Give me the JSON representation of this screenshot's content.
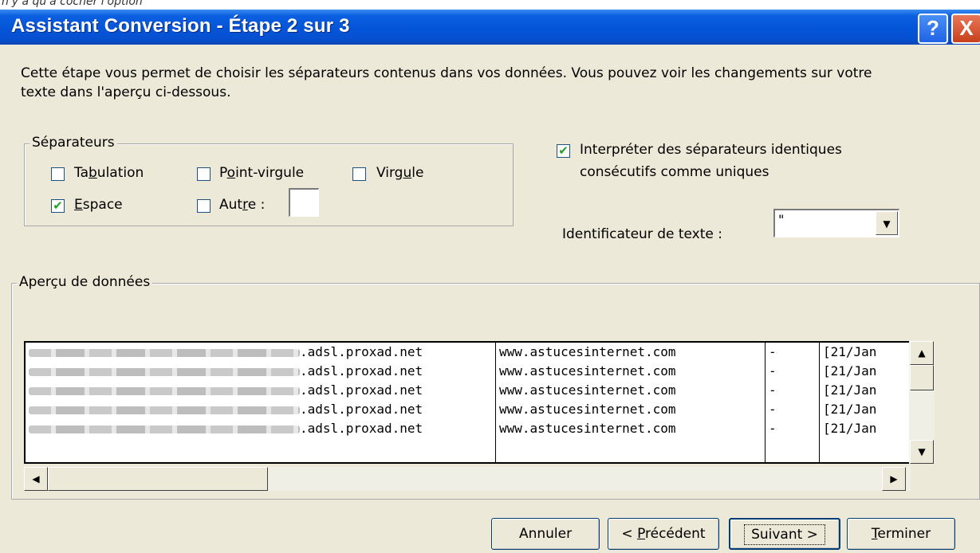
{
  "window": {
    "top_caption": "n'y a qu'à cocher l'option",
    "title": "Assistant Conversion - Étape 2 sur 3",
    "help_label": "?",
    "close_label": "X"
  },
  "description": "Cette étape vous permet de choisir les séparateurs contenus dans vos données. Vous pouvez voir les changements sur votre texte dans l'aperçu ci-dessous.",
  "separators": {
    "group_label": "Séparateurs",
    "tabulation": {
      "label": "Tabulation",
      "checked": false
    },
    "point_virgule": {
      "label": "Point-virgule",
      "checked": false
    },
    "virgule": {
      "label": "Virgule",
      "checked": false
    },
    "espace": {
      "label": "Espace",
      "checked": true
    },
    "autre": {
      "label": "Autre :",
      "checked": false,
      "value": ""
    }
  },
  "consecutive": {
    "checked": true,
    "line1": "Interpréter des séparateurs identiques",
    "line2": "consécutifs comme uniques"
  },
  "text_qualifier": {
    "label": "Identificateur de texte :",
    "value": "\""
  },
  "preview": {
    "group_label": "Aperçu de données",
    "rows": [
      {
        "host": ".adsl.proxad.net",
        "site": "www.astucesinternet.com",
        "dash": "-",
        "date": "[21/Jan"
      },
      {
        "host": ".adsl.proxad.net",
        "site": "www.astucesinternet.com",
        "dash": "-",
        "date": "[21/Jan"
      },
      {
        "host": ".adsl.proxad.net",
        "site": "www.astucesinternet.com",
        "dash": "-",
        "date": "[21/Jan"
      },
      {
        "host": ".adsl.proxad.net",
        "site": "www.astucesinternet.com",
        "dash": "-",
        "date": "[21/Jan"
      },
      {
        "host": ".adsl.proxad.net",
        "site": "www.astucesinternet.com",
        "dash": "-",
        "date": "[21/Jan"
      }
    ]
  },
  "buttons": {
    "annuler": "Annuler",
    "precedent": "< Précédent",
    "suivant": "Suivant >",
    "terminer": "Terminer"
  },
  "check_mark": "✔"
}
